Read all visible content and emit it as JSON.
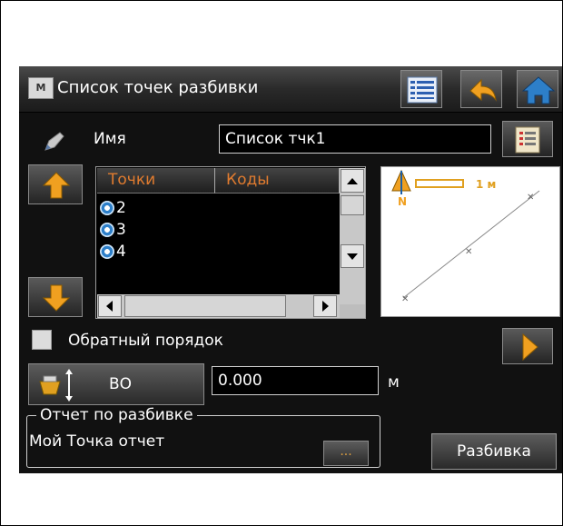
{
  "window": {
    "app_icon_text": "M",
    "title": "Список точек разбивки"
  },
  "name_field": {
    "label": "Имя",
    "value": "Список тчк1"
  },
  "list": {
    "columns": [
      "Точки",
      "Коды"
    ],
    "rows": [
      {
        "point": "2",
        "code": ""
      },
      {
        "point": "3",
        "code": ""
      },
      {
        "point": "4",
        "code": ""
      }
    ]
  },
  "map": {
    "north_label": "N",
    "scale_label": "1 м"
  },
  "reverse_order": {
    "label": "Обратный порядок",
    "checked": false
  },
  "height": {
    "mode_label": "ВО",
    "value": "0.000",
    "unit": "м"
  },
  "report": {
    "group_title": "Отчет по разбивке",
    "value": "Мой Точка отчет",
    "browse_label": "..."
  },
  "stakeout_button_label": "Разбивка",
  "colors": {
    "background": "#111111",
    "header_text": "#e07b2f",
    "accent_orange": "#f0a020",
    "accent_blue": "#2d7fc9"
  }
}
